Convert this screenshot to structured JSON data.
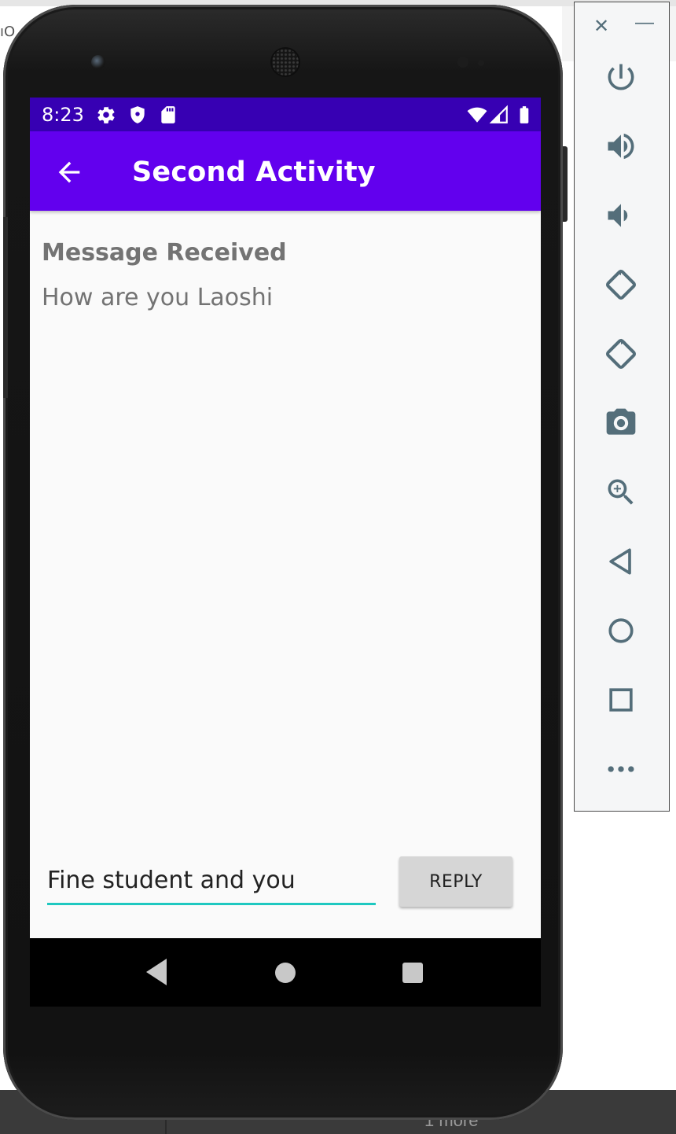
{
  "background": {
    "left_fragment": "ıO",
    "bottom_more": "1 more"
  },
  "status_bar": {
    "time": "8:23",
    "icons": [
      "settings-icon",
      "shield-icon",
      "sd-card-icon",
      "wifi-icon",
      "signal-icon",
      "battery-icon"
    ]
  },
  "app_bar": {
    "title": "Second Activity",
    "nav_icon": "arrow-back-icon"
  },
  "content": {
    "heading": "Message Received",
    "message": "How are you Laoshi"
  },
  "reply": {
    "input_value": "Fine student and you",
    "button_label": "REPLY"
  },
  "nav_bar": {
    "buttons": [
      "back-triangle-icon",
      "home-circle-icon",
      "recents-square-icon"
    ]
  },
  "toolbar": {
    "close_glyph": "✕",
    "minimize_glyph": "—",
    "buttons": [
      "power-icon",
      "volume-up-icon",
      "volume-down-icon",
      "rotate-left-icon",
      "rotate-right-icon",
      "camera-icon",
      "zoom-icon",
      "back-icon",
      "home-icon",
      "overview-icon",
      "more-icon"
    ]
  },
  "colors": {
    "status_bar": "#3700b3",
    "app_bar": "#6200ee",
    "input_underline": "#1ec8c0",
    "toolbar_icon": "#546e7a"
  }
}
